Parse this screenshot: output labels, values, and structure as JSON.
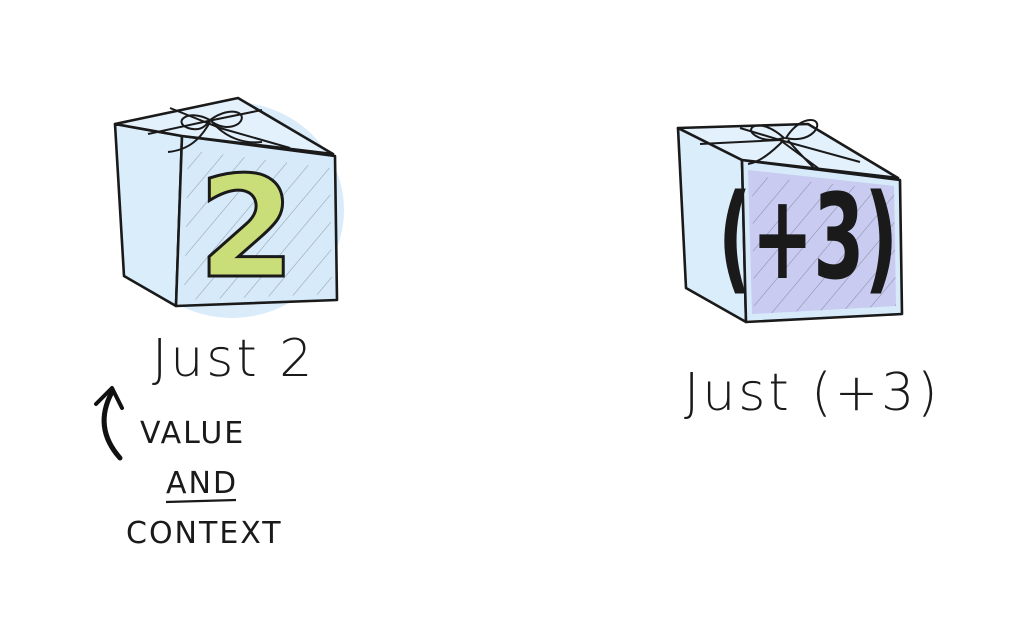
{
  "left_box": {
    "number": "2",
    "caption": "Just 2",
    "number_color": "#c9dd78",
    "box_color": "#d6eafa"
  },
  "right_box": {
    "number": "(+3)",
    "caption": "Just (+3)",
    "number_color": "#c7c6ee",
    "box_color": "#d6eafa"
  },
  "annotation": {
    "line1": "VALUE",
    "line2": "AND",
    "line3": "CONTEXT"
  }
}
